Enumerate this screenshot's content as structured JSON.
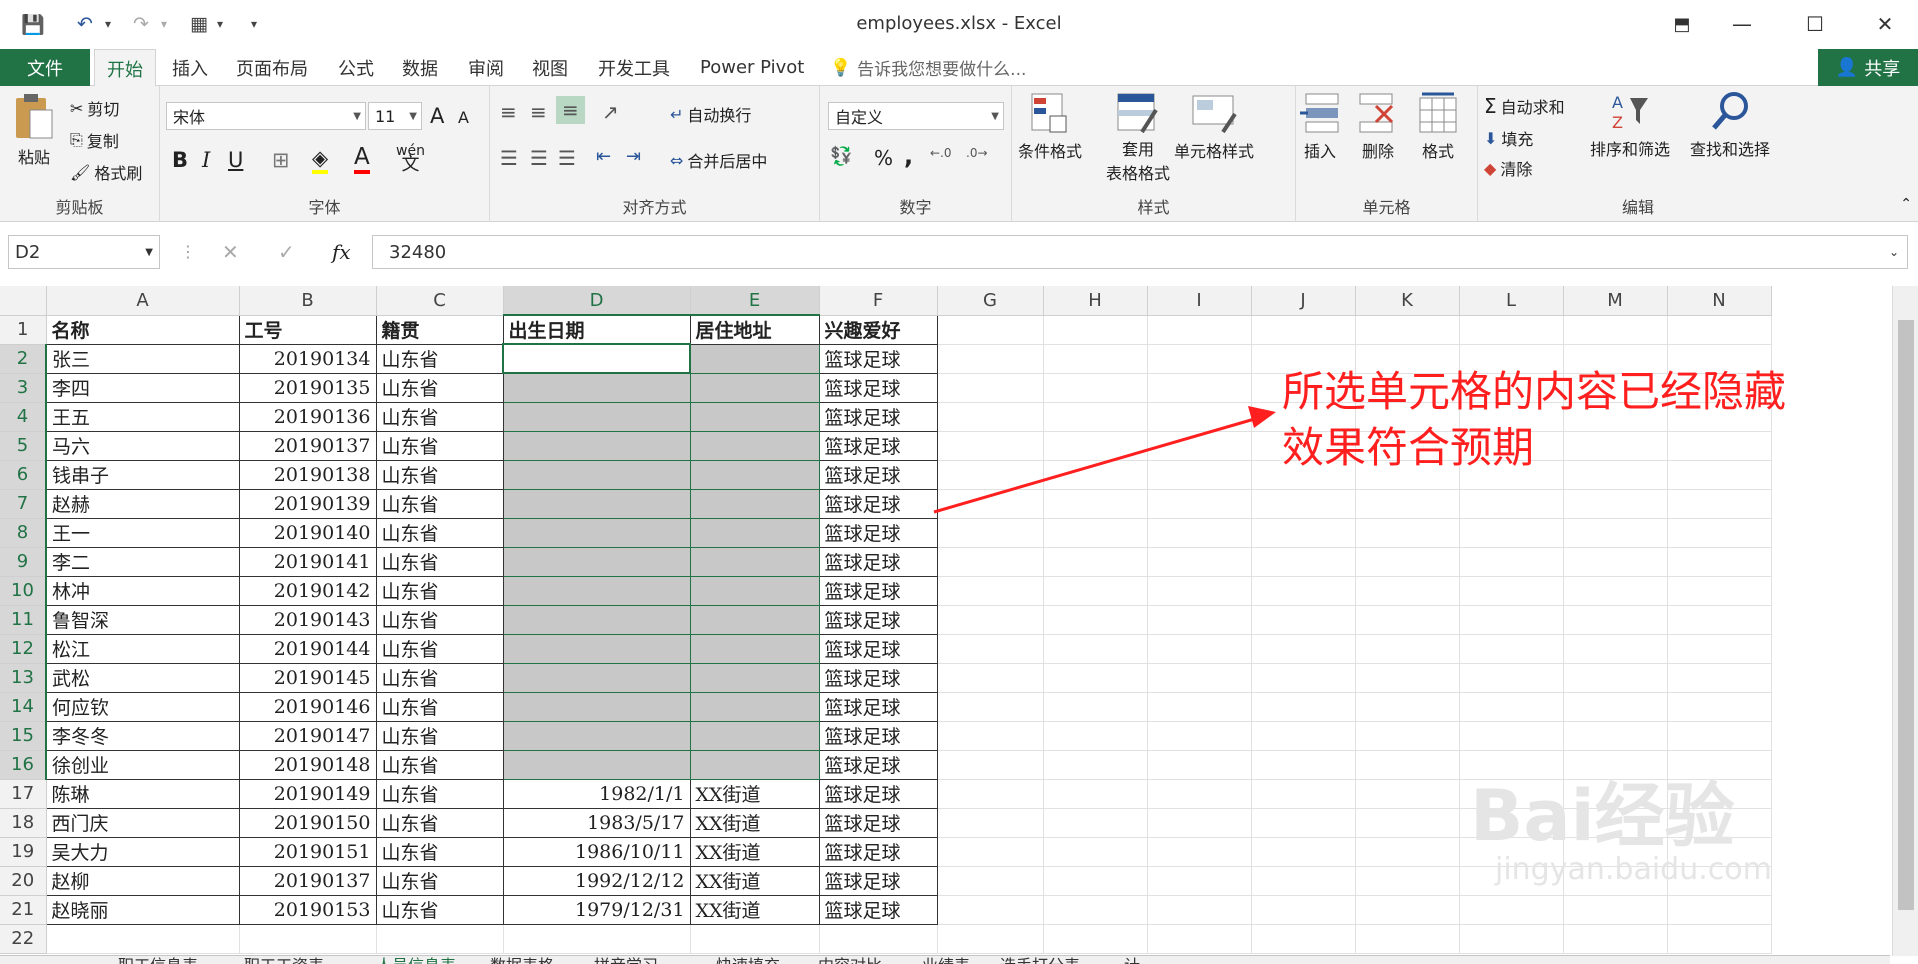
{
  "window": {
    "title": "employees.xlsx - Excel",
    "qat": {
      "save": "💾",
      "undo": "↶",
      "redo": "↷",
      "form": "▦",
      "more": "▾"
    },
    "controls": {
      "ribbon_opts": "⬒",
      "minimize": "—",
      "maximize": "☐",
      "close": "✕"
    }
  },
  "tabs": {
    "file": "文件",
    "items": [
      "开始",
      "插入",
      "页面布局",
      "公式",
      "数据",
      "审阅",
      "视图",
      "开发工具",
      "Power Pivot"
    ],
    "tell_me": "告诉我您想要做什么...",
    "share": "共享"
  },
  "ribbon": {
    "clipboard": {
      "paste": "粘贴",
      "cut": "剪切",
      "copy": "复制",
      "format_painter": "格式刷",
      "label": "剪贴板"
    },
    "font": {
      "name": "宋体",
      "size": "11",
      "bold": "B",
      "italic": "I",
      "underline": "U",
      "grow": "A",
      "shrink": "A",
      "phonetic": "wén",
      "label": "字体"
    },
    "alignment": {
      "wrap": "自动换行",
      "merge": "合并后居中",
      "label": "对齐方式"
    },
    "number": {
      "format": "自定义",
      "percent": "%",
      "comma": ",",
      "label": "数字"
    },
    "styles": {
      "conditional": "条件格式",
      "table_fmt_1": "套用",
      "table_fmt_2": "表格格式",
      "cell_styles": "单元格样式",
      "label": "样式"
    },
    "cells": {
      "insert": "插入",
      "delete": "删除",
      "format": "格式",
      "label": "单元格"
    },
    "editing": {
      "autosum": "自动求和",
      "fill": "填充",
      "clear": "清除",
      "sort": "排序和筛选",
      "find": "查找和选择",
      "label": "编辑"
    }
  },
  "formula_bar": {
    "name_box": "D2",
    "fx": "fx",
    "cancel": "✕",
    "enter": "✓",
    "value": "32480"
  },
  "columns": [
    "A",
    "B",
    "C",
    "D",
    "E",
    "F",
    "G",
    "H",
    "I",
    "J",
    "K",
    "L",
    "M",
    "N"
  ],
  "header_row": [
    "名称",
    "工号",
    "籍贯",
    "出生日期",
    "居住地址",
    "兴趣爱好"
  ],
  "rows": [
    {
      "n": "2",
      "name": "张三",
      "id": "20190134",
      "home": "山东省",
      "dob": "",
      "addr": "",
      "hobby": "篮球足球"
    },
    {
      "n": "3",
      "name": "李四",
      "id": "20190135",
      "home": "山东省",
      "dob": "",
      "addr": "",
      "hobby": "篮球足球"
    },
    {
      "n": "4",
      "name": "王五",
      "id": "20190136",
      "home": "山东省",
      "dob": "",
      "addr": "",
      "hobby": "篮球足球"
    },
    {
      "n": "5",
      "name": "马六",
      "id": "20190137",
      "home": "山东省",
      "dob": "",
      "addr": "",
      "hobby": "篮球足球"
    },
    {
      "n": "6",
      "name": "钱串子",
      "id": "20190138",
      "home": "山东省",
      "dob": "",
      "addr": "",
      "hobby": "篮球足球"
    },
    {
      "n": "7",
      "name": "赵赫",
      "id": "20190139",
      "home": "山东省",
      "dob": "",
      "addr": "",
      "hobby": "篮球足球"
    },
    {
      "n": "8",
      "name": "王一",
      "id": "20190140",
      "home": "山东省",
      "dob": "",
      "addr": "",
      "hobby": "篮球足球"
    },
    {
      "n": "9",
      "name": "李二",
      "id": "20190141",
      "home": "山东省",
      "dob": "",
      "addr": "",
      "hobby": "篮球足球"
    },
    {
      "n": "10",
      "name": "林冲",
      "id": "20190142",
      "home": "山东省",
      "dob": "",
      "addr": "",
      "hobby": "篮球足球"
    },
    {
      "n": "11",
      "name": "鲁智深",
      "id": "20190143",
      "home": "山东省",
      "dob": "",
      "addr": "",
      "hobby": "篮球足球"
    },
    {
      "n": "12",
      "name": "松江",
      "id": "20190144",
      "home": "山东省",
      "dob": "",
      "addr": "",
      "hobby": "篮球足球"
    },
    {
      "n": "13",
      "name": "武松",
      "id": "20190145",
      "home": "山东省",
      "dob": "",
      "addr": "",
      "hobby": "篮球足球"
    },
    {
      "n": "14",
      "name": "何应钦",
      "id": "20190146",
      "home": "山东省",
      "dob": "",
      "addr": "",
      "hobby": "篮球足球"
    },
    {
      "n": "15",
      "name": "李冬冬",
      "id": "20190147",
      "home": "山东省",
      "dob": "",
      "addr": "",
      "hobby": "篮球足球"
    },
    {
      "n": "16",
      "name": "徐创业",
      "id": "20190148",
      "home": "山东省",
      "dob": "",
      "addr": "",
      "hobby": "篮球足球"
    },
    {
      "n": "17",
      "name": "陈琳",
      "id": "20190149",
      "home": "山东省",
      "dob": "1982/1/1",
      "addr": "XX街道",
      "hobby": "篮球足球"
    },
    {
      "n": "18",
      "name": "西门庆",
      "id": "20190150",
      "home": "山东省",
      "dob": "1983/5/17",
      "addr": "XX街道",
      "hobby": "篮球足球"
    },
    {
      "n": "19",
      "name": "吴大力",
      "id": "20190151",
      "home": "山东省",
      "dob": "1986/10/11",
      "addr": "XX街道",
      "hobby": "篮球足球"
    },
    {
      "n": "20",
      "name": "赵柳",
      "id": "20190137",
      "home": "山东省",
      "dob": "1992/12/12",
      "addr": "XX街道",
      "hobby": "篮球足球"
    },
    {
      "n": "21",
      "name": "赵晓丽",
      "id": "20190153",
      "home": "山东省",
      "dob": "1979/12/31",
      "addr": "XX街道",
      "hobby": "篮球足球"
    }
  ],
  "annotation": {
    "line1": "所选单元格的内容已经隐藏",
    "line2": "效果符合预期",
    "color": "#ff1f1f"
  },
  "sheet_tabs": [
    "职工信息表",
    "职工工资表",
    "人员信息表",
    "数据表格",
    "拼音学习",
    "快速填充",
    "内容对比",
    "业绩表",
    "选手打分表",
    "计"
  ],
  "watermark": {
    "brand": "Bai经验",
    "url": "jingyan.baidu.com"
  },
  "colors": {
    "excel_green": "#217346",
    "hidden_fill": "#c8c8c8"
  }
}
